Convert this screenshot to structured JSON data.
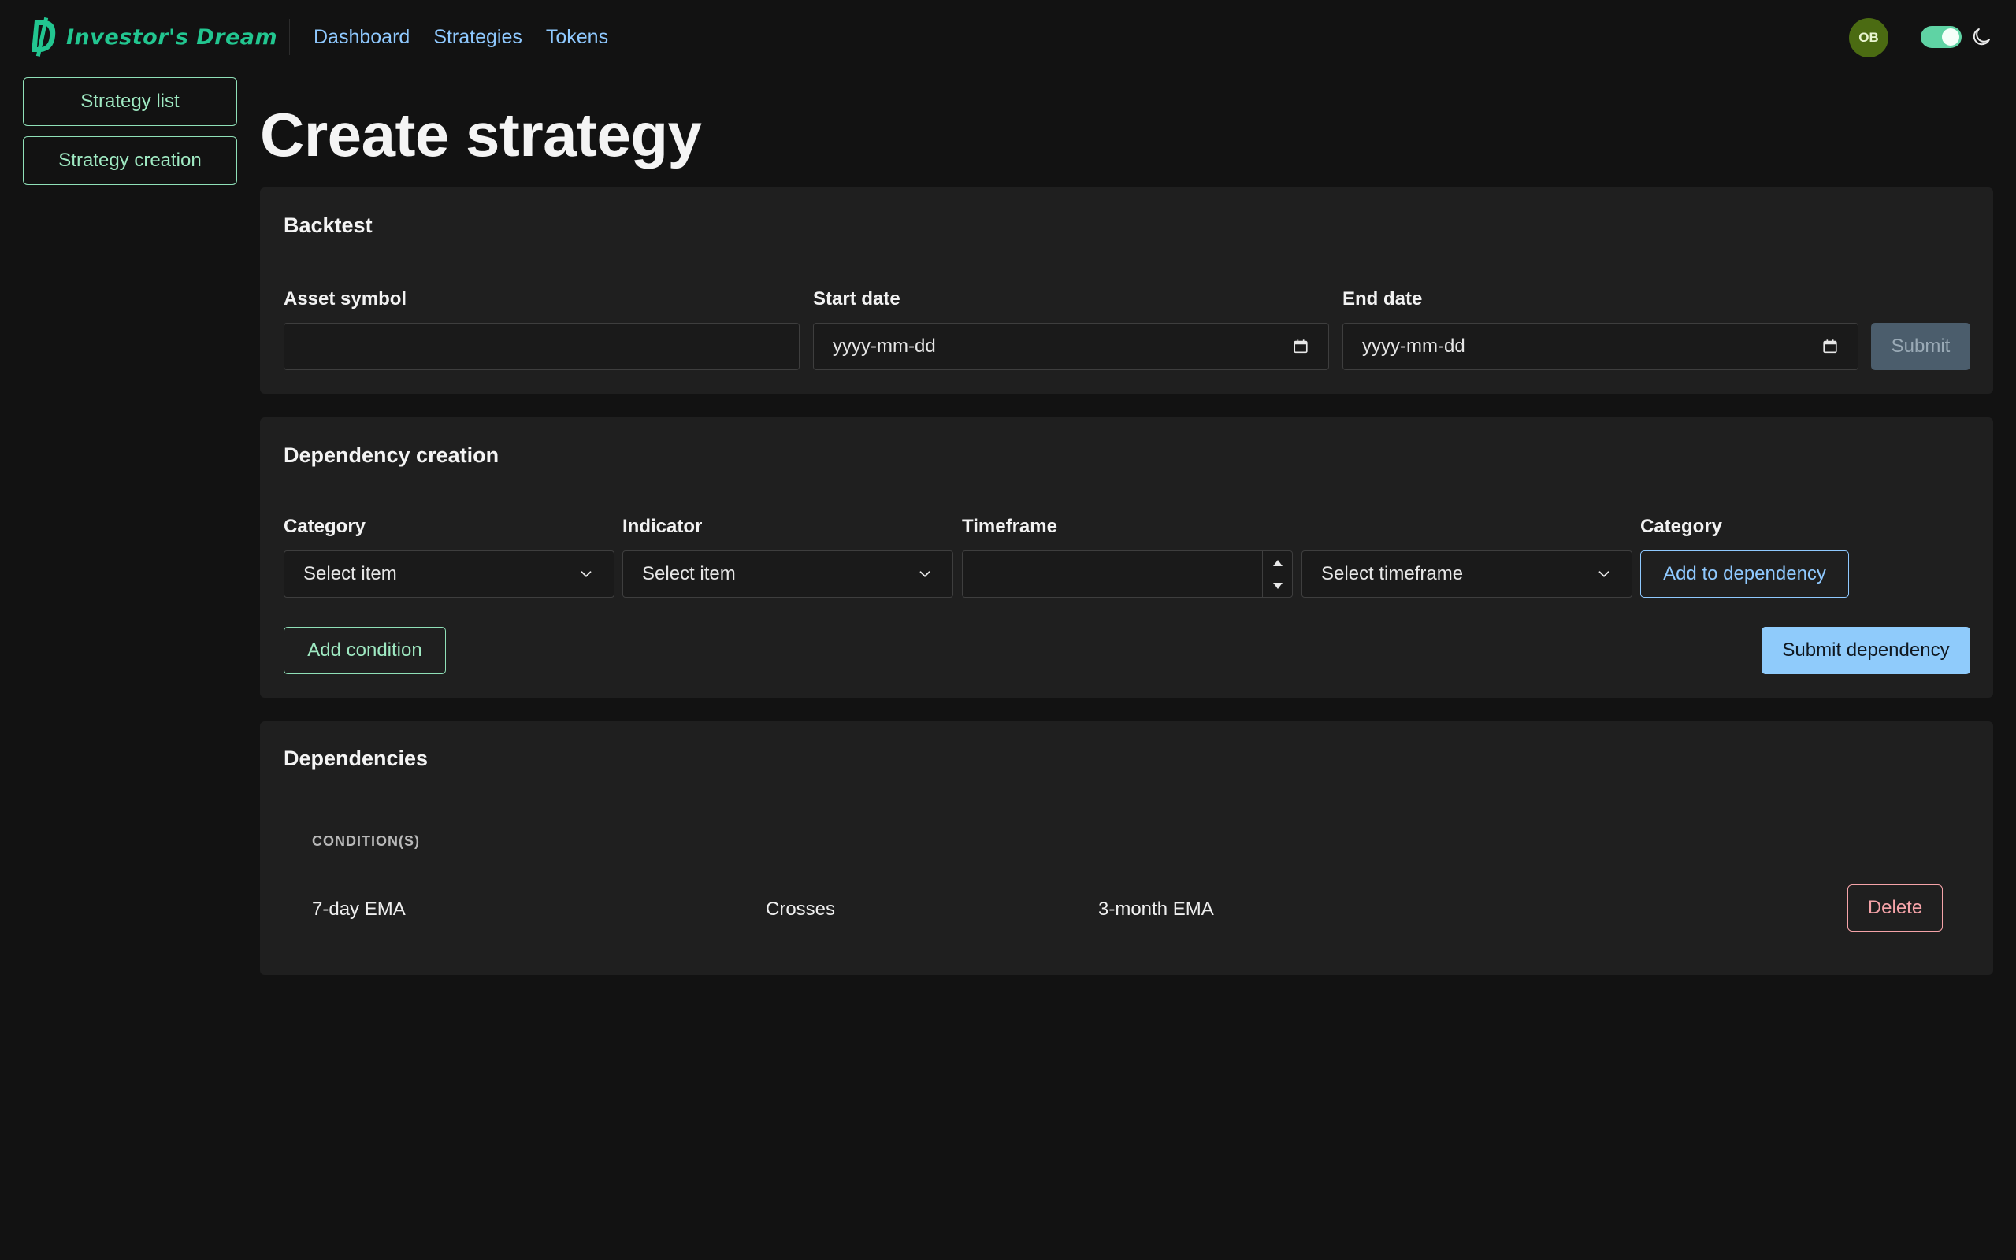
{
  "brand": {
    "name": "Investor's Dream",
    "accent_color": "#22c690"
  },
  "nav": {
    "links": [
      "Dashboard",
      "Strategies",
      "Tokens"
    ]
  },
  "user": {
    "initials": "OB"
  },
  "theme_toggle": {
    "state": "on",
    "icon": "moon-icon"
  },
  "sidebar": {
    "items": [
      "Strategy list",
      "Strategy creation"
    ]
  },
  "page": {
    "title": "Create strategy"
  },
  "backtest": {
    "title": "Backtest",
    "asset_label": "Asset symbol",
    "asset_value": "",
    "start_label": "Start date",
    "start_placeholder": "yyyy-mm-dd",
    "end_label": "End date",
    "end_placeholder": "yyyy-mm-dd",
    "submit_label": "Submit"
  },
  "dependency_creation": {
    "title": "Dependency creation",
    "category_label": "Category",
    "category_value": "Select item",
    "indicator_label": "Indicator",
    "indicator_value": "Select item",
    "timeframe_label": "Timeframe",
    "timeframe_value": "",
    "timeframe_select_value": "Select timeframe",
    "category2_label": "Category",
    "add_to_dependency_label": "Add to dependency",
    "add_condition_label": "Add condition",
    "submit_dependency_label": "Submit dependency"
  },
  "dependencies": {
    "title": "Dependencies",
    "column_header": "CONDITION(S)",
    "rows": [
      {
        "left": "7-day EMA",
        "operator": "Crosses",
        "right": "3-month EMA",
        "action": "Delete"
      }
    ]
  }
}
